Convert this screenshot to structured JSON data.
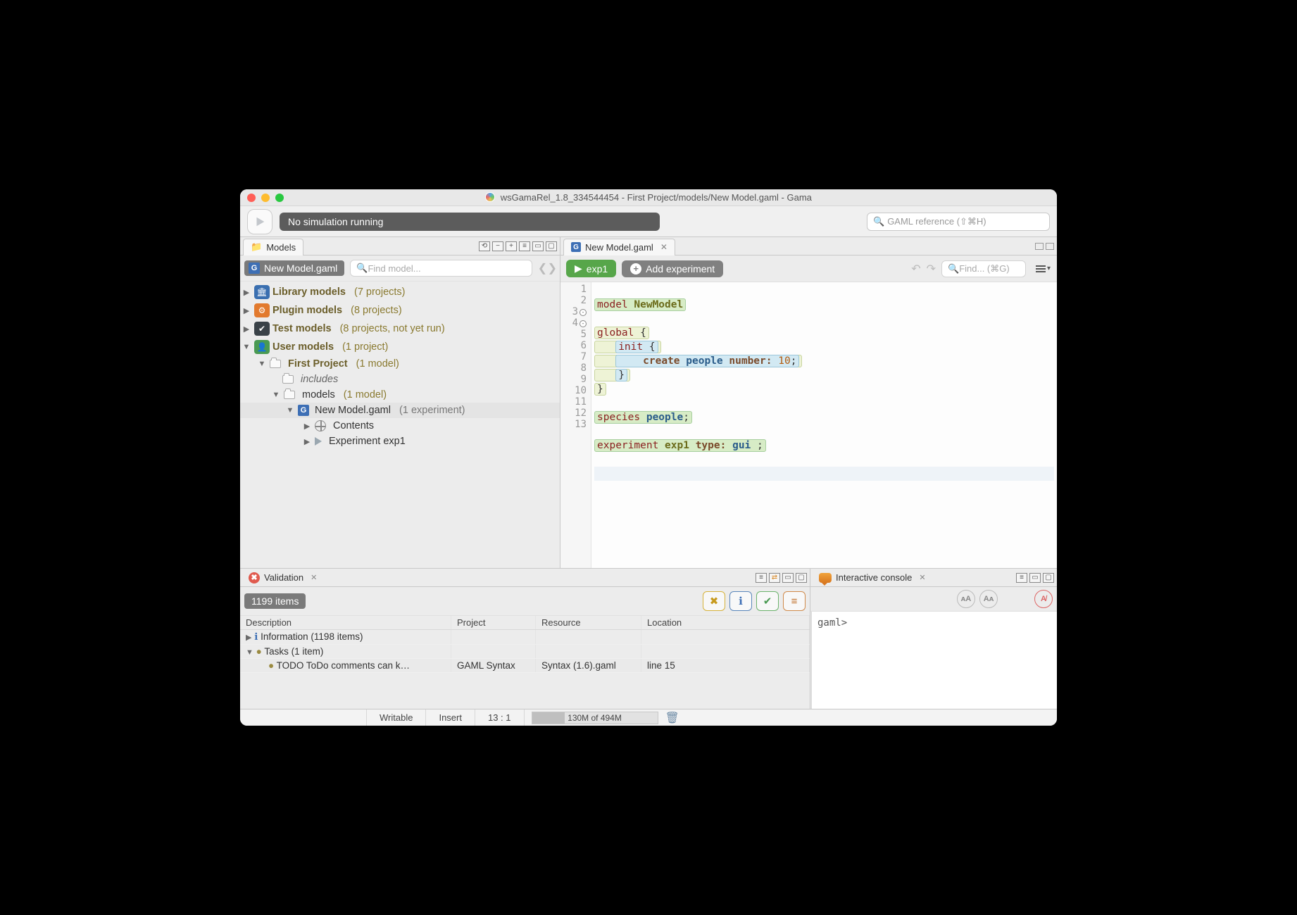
{
  "window": {
    "title": "wsGamaRel_1.8_334544454 - First Project/models/New Model.gaml - Gama"
  },
  "toolbar": {
    "sim_status": "No simulation running",
    "search_placeholder": "GAML reference (⇧⌘H)"
  },
  "models_view": {
    "title": "Models",
    "file_chip": "New Model.gaml",
    "find_placeholder": "Find model...",
    "tree": {
      "lib": {
        "label": "Library models",
        "count": "(7 projects)"
      },
      "plug": {
        "label": "Plugin models",
        "count": "(8 projects)"
      },
      "test": {
        "label": "Test models",
        "count": "(8 projects, not yet run)"
      },
      "user": {
        "label": "User models",
        "count": "(1 project)"
      },
      "project": {
        "label": "First Project",
        "count": "(1 model)"
      },
      "includes": {
        "label": "includes"
      },
      "models": {
        "label": "models",
        "count": "(1 model)"
      },
      "file": {
        "label": "New Model.gaml",
        "count": "(1 experiment)"
      },
      "contents": {
        "label": "Contents"
      },
      "exp": {
        "label": "Experiment exp1"
      }
    }
  },
  "editor": {
    "tab_title": "New Model.gaml",
    "run_label": "exp1",
    "add_label": "Add experiment",
    "find_placeholder": "Find... (⌘G)",
    "lines": {
      "l1a": "model",
      "l1b": "NewModel",
      "l3a": "global",
      "l3b": "{",
      "l4a": "init",
      "l4b": "{",
      "l5a": "create",
      "l5b": "people",
      "l5c": "number:",
      "l5d": "10",
      "l5e": ";",
      "l6": "}",
      "l7": "}",
      "l9a": "species",
      "l9b": "people",
      "l9c": ";",
      "l11a": "experiment",
      "l11b": "exp1",
      "l11c": "type:",
      "l11d": "gui",
      "l11e": ";"
    },
    "gutter": [
      "1",
      "2",
      "3",
      "4",
      "5",
      "6",
      "7",
      "8",
      "9",
      "10",
      "11",
      "12",
      "13"
    ]
  },
  "validation": {
    "title": "Validation",
    "count_chip": "1199 items",
    "headers": {
      "desc": "Description",
      "proj": "Project",
      "res": "Resource",
      "loc": "Location"
    },
    "rows": {
      "info": {
        "desc": "Information (1198 items)"
      },
      "tasks": {
        "desc": "Tasks (1 item)"
      },
      "todo": {
        "desc": "TODO ToDo comments can k…",
        "proj": "GAML Syntax",
        "res": "Syntax (1.6).gaml",
        "loc": "line 15"
      }
    }
  },
  "console": {
    "title": "Interactive console",
    "prompt": "gaml>"
  },
  "statusbar": {
    "writable": "Writable",
    "mode": "Insert",
    "pos": "13 : 1",
    "mem": "130M of 494M"
  }
}
